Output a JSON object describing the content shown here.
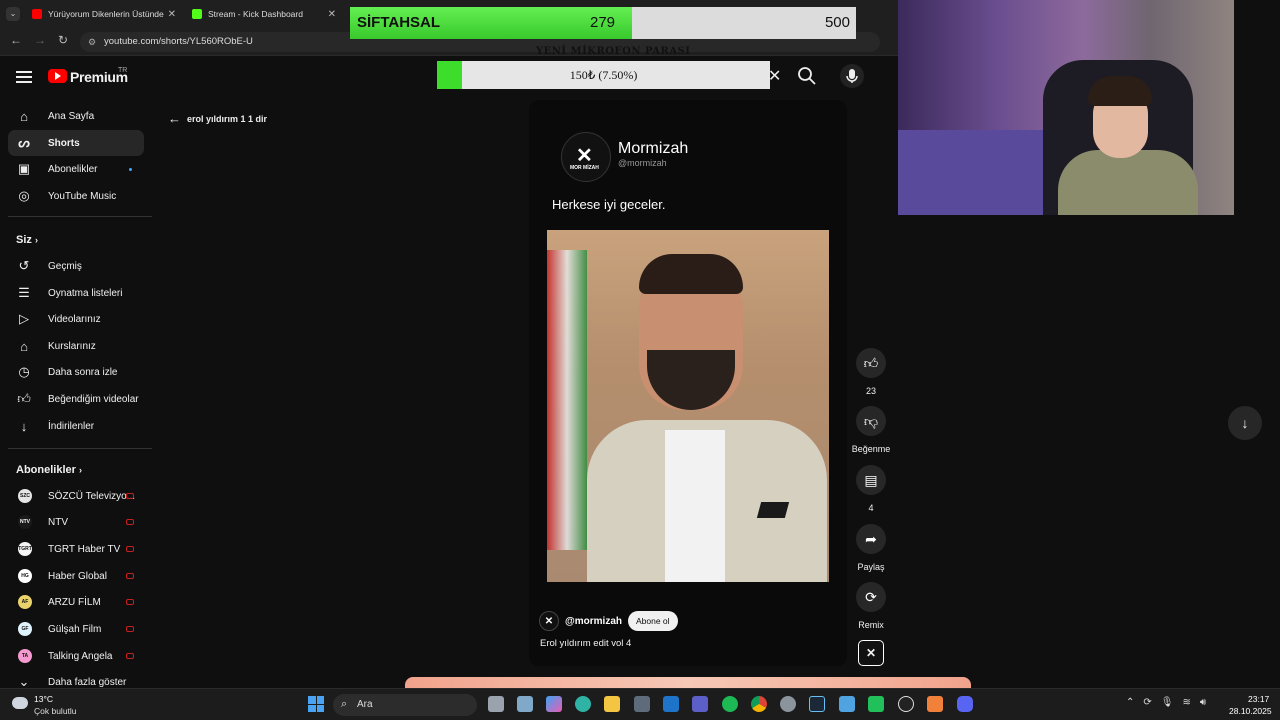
{
  "browser": {
    "tabs": [
      {
        "title": "Yürüyorum Dikenlerin Üstünde"
      },
      {
        "title": "Stream - Kick Dashboard"
      }
    ],
    "url": "youtube.com/shorts/YL560RObE-U"
  },
  "overlay": {
    "goal_name": "SİFTAHSAL",
    "goal_current": "279",
    "goal_max": "500",
    "goal_fraction": 0.558,
    "mic_label": "YENİ MİKROFON PARASI",
    "donation_text": "150₺ (7.50%)",
    "donation_fraction": 0.075
  },
  "header": {
    "logo_text": "Premium",
    "region": "TR"
  },
  "sidebar": {
    "main": [
      {
        "label": "Ana Sayfa",
        "icon": "home-icon"
      },
      {
        "label": "Shorts",
        "icon": "shorts-icon"
      },
      {
        "label": "Abonelikler",
        "icon": "subscriptions-icon"
      },
      {
        "label": "YouTube Music",
        "icon": "music-icon"
      }
    ],
    "you_heading": "Siz",
    "you": [
      {
        "label": "Geçmiş",
        "icon": "history-icon"
      },
      {
        "label": "Oynatma listeleri",
        "icon": "playlist-icon"
      },
      {
        "label": "Videolarınız",
        "icon": "your-videos-icon"
      },
      {
        "label": "Kurslarınız",
        "icon": "courses-icon"
      },
      {
        "label": "Daha sonra izle",
        "icon": "watch-later-icon"
      },
      {
        "label": "Beğendiğim videolar",
        "icon": "liked-icon"
      },
      {
        "label": "İndirilenler",
        "icon": "download-icon"
      }
    ],
    "subs_heading": "Abonelikler",
    "subs": [
      {
        "label": "SÖZCÜ Televizyo...",
        "avatar": "SZC",
        "color": "#e5e5e5"
      },
      {
        "label": "NTV",
        "avatar": "NTV",
        "color": "#1a1a1a"
      },
      {
        "label": "TGRT Haber TV",
        "avatar": "TGRT",
        "color": "#f5f5f5"
      },
      {
        "label": "Haber Global",
        "avatar": "HG",
        "color": "#ffffff"
      },
      {
        "label": "ARZU FİLM",
        "avatar": "AF",
        "color": "#e9d36a"
      },
      {
        "label": "Gülşah Film",
        "avatar": "GF",
        "color": "#dff3ff"
      },
      {
        "label": "Talking Angela",
        "avatar": "TA",
        "color": "#f59ad0"
      }
    ],
    "more": "Daha fazla göster"
  },
  "page": {
    "back_label": "erol yıldırım 1 1 dir"
  },
  "short": {
    "post_name": "Mormizah",
    "post_handle": "@mormizah",
    "post_logo_text": "MOR MİZAH",
    "post_caption": "Herkese iyi geceler.",
    "channel_handle": "@mormizah",
    "subscribe_label": "Abone ol",
    "title": "Erol yıldırım edit vol 4"
  },
  "actions": {
    "likes": "23",
    "dislike_label": "Beğenme",
    "comments": "4",
    "share_label": "Paylaş",
    "remix_label": "Remix"
  },
  "taskbar": {
    "weather_temp": "13°C",
    "weather_desc": "Çok bulutlu",
    "search_label": "Ara",
    "time": "23:17",
    "date": "28.10.2025"
  }
}
